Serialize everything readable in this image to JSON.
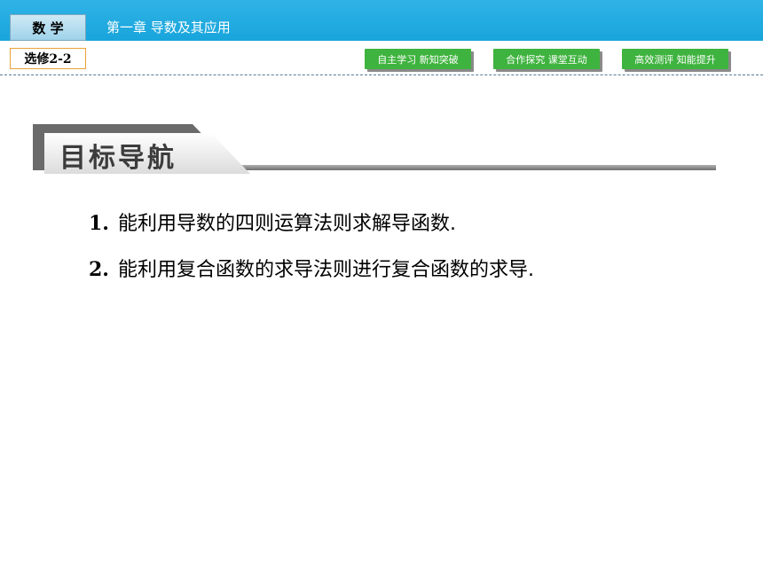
{
  "header": {
    "subject": "数 学",
    "chapter": "第一章   导数及其应用",
    "edition": "选修2-2",
    "nav": [
      {
        "label": "自主学习 新知突破"
      },
      {
        "label": "合作探究 课堂互动"
      },
      {
        "label": "高效测评 知能提升"
      }
    ]
  },
  "section": {
    "title": "目标导航"
  },
  "goals": [
    {
      "num": "1.",
      "text": "能利用导数的四则运算法则求解导函数."
    },
    {
      "num": "2.",
      "text": "能利用复合函数的求导法则进行复合函数的求导."
    }
  ],
  "colors": {
    "header_blue": "#18a5dc",
    "nav_green": "#3fb33f",
    "edition_border": "#e8a23b"
  }
}
